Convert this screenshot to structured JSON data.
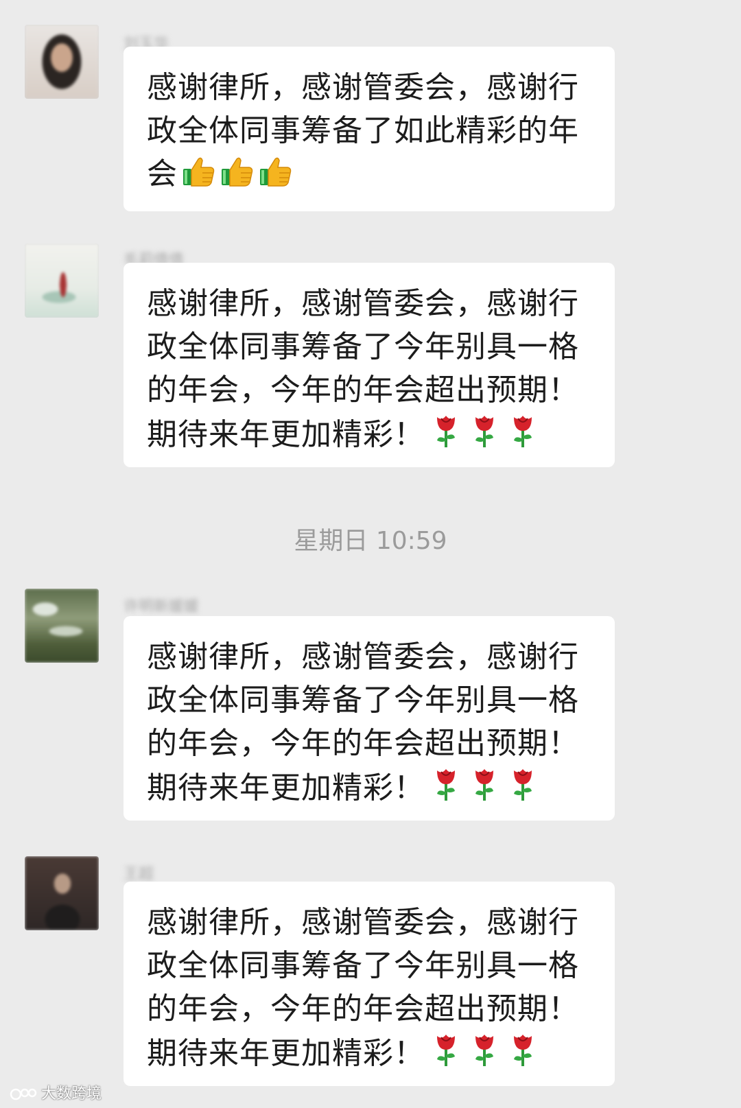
{
  "chat": {
    "messages": [
      {
        "sender": "刘玉华",
        "text": "感谢律所，感谢管委会，感谢行政全体同事筹备了如此精彩的年会",
        "emoji": "thumbs-up-icon",
        "emoji_count": 3
      },
      {
        "sender": "毛莉倩倩",
        "text": "感谢律所，感谢管委会，感谢行政全体同事筹备了今年别具一格的年会，今年的年会超出预期！期待来年更加精彩！",
        "emoji": "rose-icon",
        "emoji_count": 3
      },
      {
        "sender": "许明新媛媛",
        "text": "感谢律所，感谢管委会，感谢行政全体同事筹备了今年别具一格的年会，今年的年会超出预期！期待来年更加精彩！",
        "emoji": "rose-icon",
        "emoji_count": 3
      },
      {
        "sender": "王超",
        "text": "感谢律所，感谢管委会，感谢行政全体同事筹备了今年别具一格的年会，今年的年会超出预期！期待来年更加精彩！",
        "emoji": "rose-icon",
        "emoji_count": 3
      }
    ],
    "timestamp": "星期日 10:59"
  },
  "watermark": {
    "text": "大数跨境"
  },
  "colors": {
    "background": "#ebebeb",
    "bubble": "#ffffff",
    "text": "#1c1c1c",
    "timestamp": "#9b9b9b"
  }
}
